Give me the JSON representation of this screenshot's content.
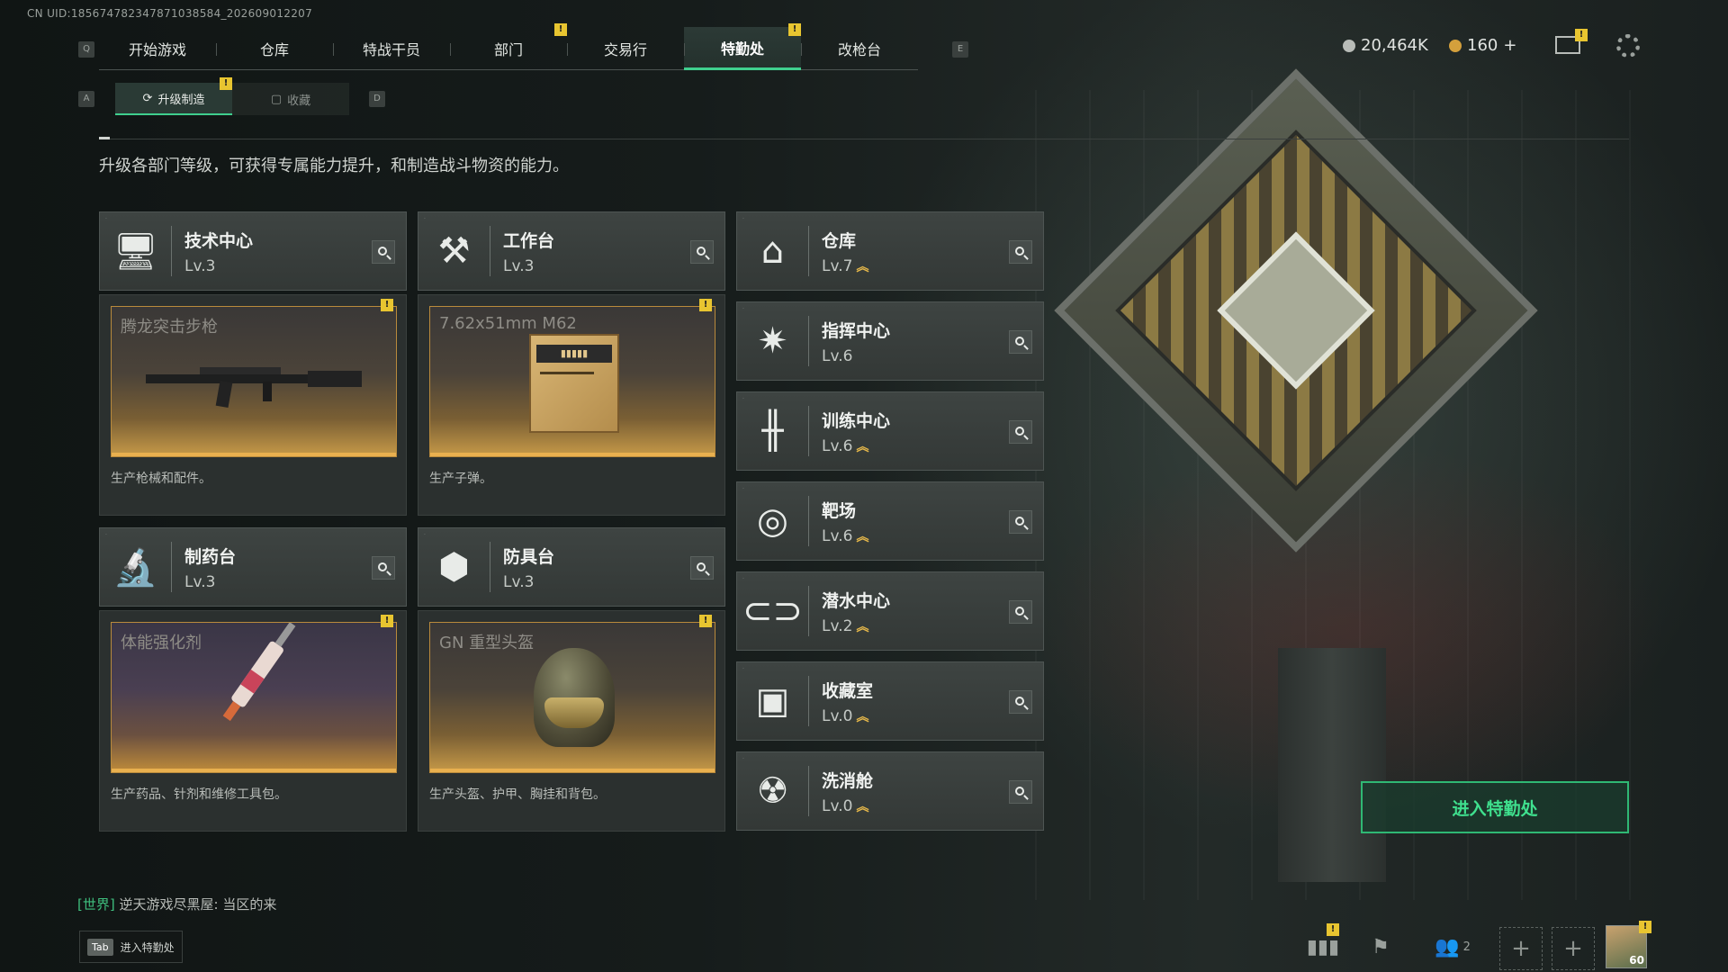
{
  "uid": "CN UID:185674782347871038584_202609012207",
  "nav": {
    "key_left": "Q",
    "key_right": "E",
    "tabs": [
      {
        "label": "开始游戏",
        "active": false,
        "badge": false
      },
      {
        "label": "仓库",
        "active": false,
        "badge": false
      },
      {
        "label": "特战干员",
        "active": false,
        "badge": false
      },
      {
        "label": "部门",
        "active": false,
        "badge": true
      },
      {
        "label": "交易行",
        "active": false,
        "badge": false
      },
      {
        "label": "特勤处",
        "active": true,
        "badge": true
      },
      {
        "label": "改枪台",
        "active": false,
        "badge": false
      }
    ]
  },
  "currency": {
    "silver": "20,464K",
    "gold": "160",
    "gold_plus": "+"
  },
  "subnav": {
    "key_left": "A",
    "key_right": "D",
    "tabs": [
      {
        "label": "升级制造",
        "active": true
      },
      {
        "label": "收藏",
        "active": false
      }
    ]
  },
  "description": "升级各部门等级，可获得专属能力提升，和制造战斗物资的能力。",
  "workshops": [
    {
      "name": "技术中心",
      "level": "Lv.3",
      "icon": "monitor-icon",
      "item": "腾龙突击步枪",
      "desc": "生产枪械和配件。"
    },
    {
      "name": "工作台",
      "level": "Lv.3",
      "icon": "tools-icon",
      "item": "7.62x51mm M62",
      "desc": "生产子弹。"
    },
    {
      "name": "制药台",
      "level": "Lv.3",
      "icon": "microscope-icon",
      "item": "体能强化剂",
      "desc": "生产药品、针剂和维修工具包。"
    },
    {
      "name": "防具台",
      "level": "Lv.3",
      "icon": "cubes-icon",
      "item": "GN 重型头盔",
      "desc": "生产头盔、护甲、胸挂和背包。"
    }
  ],
  "facilities": [
    {
      "name": "仓库",
      "level": "Lv.7",
      "icon": "warehouse-icon"
    },
    {
      "name": "指挥中心",
      "level": "Lv.6",
      "icon": "command-icon"
    },
    {
      "name": "训练中心",
      "level": "Lv.6",
      "icon": "dumbbell-icon"
    },
    {
      "name": "靶场",
      "level": "Lv.6",
      "icon": "target-icon"
    },
    {
      "name": "潜水中心",
      "level": "Lv.2",
      "icon": "goggles-icon"
    },
    {
      "name": "收藏室",
      "level": "Lv.0",
      "icon": "collection-icon"
    },
    {
      "name": "洗消舱",
      "level": "Lv.0",
      "icon": "decon-icon"
    }
  ],
  "enter_button": "进入特勤处",
  "chat": {
    "channel": "[世界]",
    "message": "逆天游戏尽黑屋: 当区的来"
  },
  "tab_hint": {
    "key": "Tab",
    "label": "进入特勤处"
  },
  "bottom_bar": {
    "friends_count": "2",
    "avatar_level": "60"
  },
  "colors": {
    "accent_green": "#3fcf8e",
    "badge_yellow": "#e8c530",
    "upgrade_gold": "#e6b84a"
  }
}
